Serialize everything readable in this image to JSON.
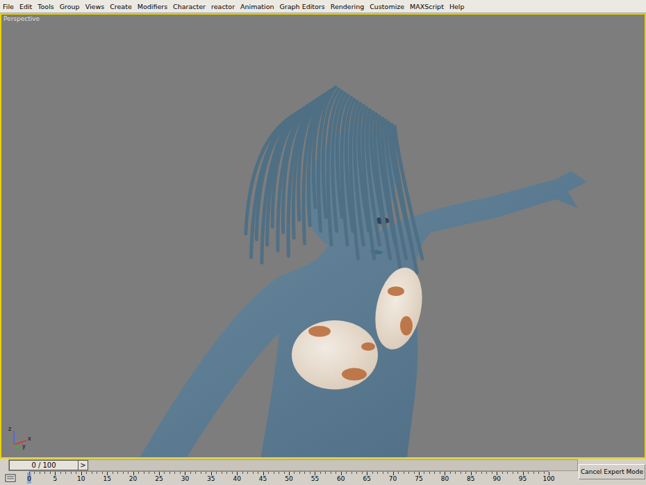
{
  "menu": [
    "File",
    "Edit",
    "Tools",
    "Group",
    "Views",
    "Create",
    "Modifiers",
    "Character",
    "reactor",
    "Animation",
    "Graph Editors",
    "Rendering",
    "Customize",
    "MAXScript",
    "Help"
  ],
  "viewport": {
    "label": "Perspective",
    "active": true,
    "axis_labels": [
      "z",
      "y",
      "x"
    ]
  },
  "time_slider": {
    "label": "0 / 100",
    "next": ">",
    "level": 0
  },
  "track_bar": {
    "ticks": [
      "0",
      "5",
      "10",
      "15",
      "20",
      "25",
      "30",
      "35",
      "40",
      "45",
      "50",
      "55",
      "60",
      "65",
      "70",
      "75",
      "80",
      "85",
      "90",
      "95",
      "100"
    ]
  },
  "buttons": [
    "Cancel Expert Mode"
  ]
}
